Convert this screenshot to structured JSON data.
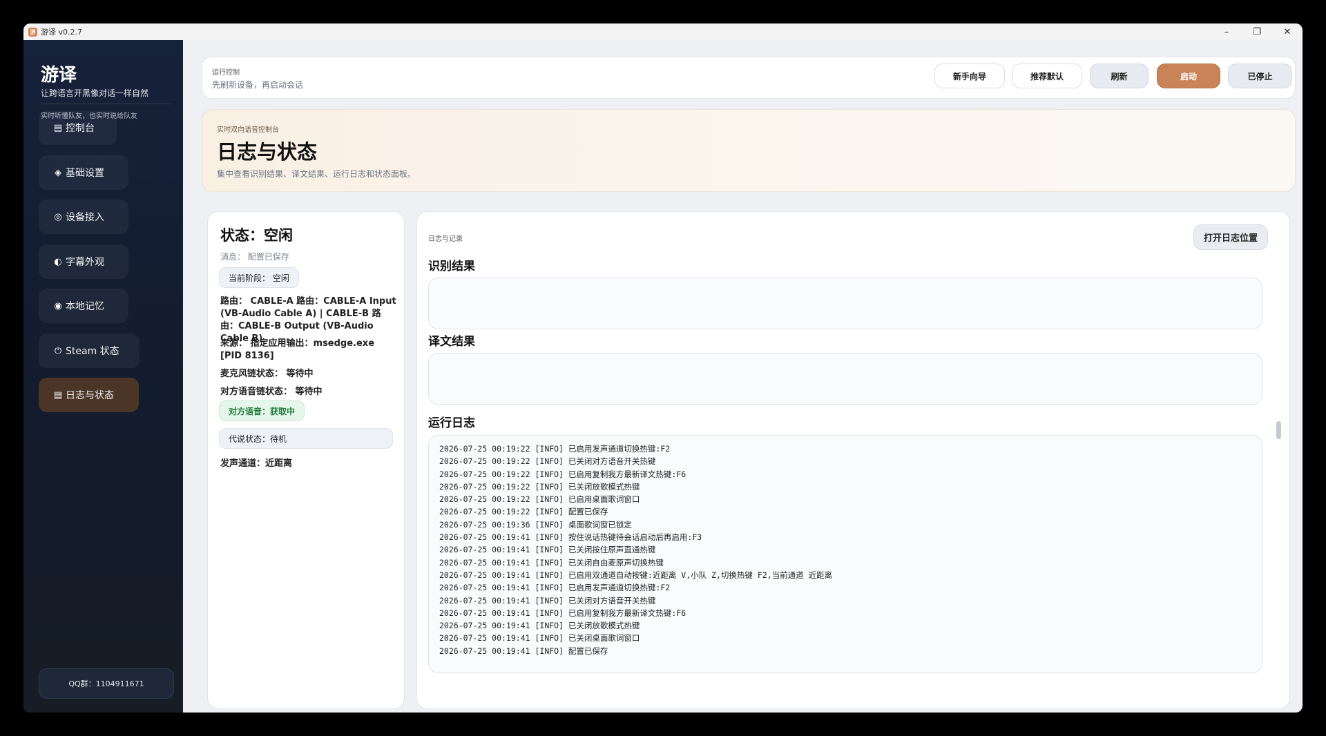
{
  "window": {
    "title": "游译 v0.2.7",
    "app_icon_glyph": "游"
  },
  "window_controls": {
    "minimize": "–",
    "maximize": "❐",
    "close": "✕"
  },
  "sidebar": {
    "brand": "游译",
    "tagline": "让跨语言开黑像对话一样自然",
    "subtagline": "实时听懂队友，也实时说给队友",
    "items": [
      {
        "label": "控制台",
        "icon": "console-icon",
        "glyph": "▤"
      },
      {
        "label": "基础设置",
        "icon": "settings-icon",
        "glyph": "◈"
      },
      {
        "label": "设备接入",
        "icon": "device-icon",
        "glyph": "◎"
      },
      {
        "label": "字幕外观",
        "icon": "caption-icon",
        "glyph": "◐"
      },
      {
        "label": "本地记忆",
        "icon": "memory-icon",
        "glyph": "◉"
      },
      {
        "label": "Steam 状态",
        "icon": "steam-icon",
        "glyph": "⏻"
      },
      {
        "label": "日志与状态",
        "icon": "log-icon",
        "glyph": "▤"
      }
    ],
    "active_index": 6,
    "qq": "QQ群：1104911671"
  },
  "topbar": {
    "label": "运行控制",
    "hint": "先刷新设备，再启动会话",
    "buttons": {
      "guide": "新手向导",
      "recommend": "推荐默认",
      "refresh": "刷新",
      "start": "启动",
      "stopped": "已停止"
    }
  },
  "hero": {
    "kicker": "实时双向语音控制台",
    "title": "日志与状态",
    "desc": "集中查看识别结果、译文结果、运行日志和状态面板。"
  },
  "status": {
    "title": "状态：空闲",
    "message": "消息：  配置已保存",
    "stage": "当前阶段：  空闲",
    "route": "路由：  CABLE-A 路由：CABLE-A Input (VB-Audio Cable A) | CABLE-B 路由：CABLE-B Output (VB-Audio Cable B)",
    "source": "来源：  指定应用输出：msedge.exe [PID 8136]",
    "mic_chain": "麦克风链状态：  等待中",
    "peer_chain": "对方语音链状态：  等待中",
    "peer_voice": "对方语音：获取中",
    "proxy": "代说状态：待机",
    "channel": "发声通道：近距离"
  },
  "logs_panel": {
    "kicker": "日志与记录",
    "open_button": "打开日志位置",
    "recognition_title": "识别结果",
    "recognition_text": "",
    "translation_title": "译文结果",
    "translation_text": "",
    "runlog_title": "运行日志",
    "lines": [
      "2026-07-25 00:19:22 [INFO] 已启用发声通道切换热键:F2",
      "2026-07-25 00:19:22 [INFO] 已关闭对方语音开关热键",
      "2026-07-25 00:19:22 [INFO] 已启用复制我方最新译文热键:F6",
      "2026-07-25 00:19:22 [INFO] 已关闭放歌模式热键",
      "2026-07-25 00:19:22 [INFO] 已启用桌面歌词窗口",
      "2026-07-25 00:19:22 [INFO] 配置已保存",
      "2026-07-25 00:19:36 [INFO] 桌面歌词窗已锁定",
      "2026-07-25 00:19:41 [INFO] 按住说话热键待会话启动后再启用:F3",
      "2026-07-25 00:19:41 [INFO] 已关闭按住原声直通热键",
      "2026-07-25 00:19:41 [INFO] 已关闭自由麦原声切换热键",
      "2026-07-25 00:19:41 [INFO] 已启用双通道自动按键:近距离 V,小队 Z,切换热键 F2,当前通道 近距离",
      "2026-07-25 00:19:41 [INFO] 已启用发声通道切换热键:F2",
      "2026-07-25 00:19:41 [INFO] 已关闭对方语音开关热键",
      "2026-07-25 00:19:41 [INFO] 已启用复制我方最新译文热键:F6",
      "2026-07-25 00:19:41 [INFO] 已关闭放歌模式热键",
      "2026-07-25 00:19:41 [INFO] 已关闭桌面歌词窗口",
      "2026-07-25 00:19:41 [INFO] 配置已保存"
    ]
  },
  "colors": {
    "accent": "#c88457",
    "sidebar_bg": "#16213a",
    "active_nav": "#4a3526",
    "success_bg": "#e6f6ea",
    "success_text": "#1f7a3a"
  }
}
